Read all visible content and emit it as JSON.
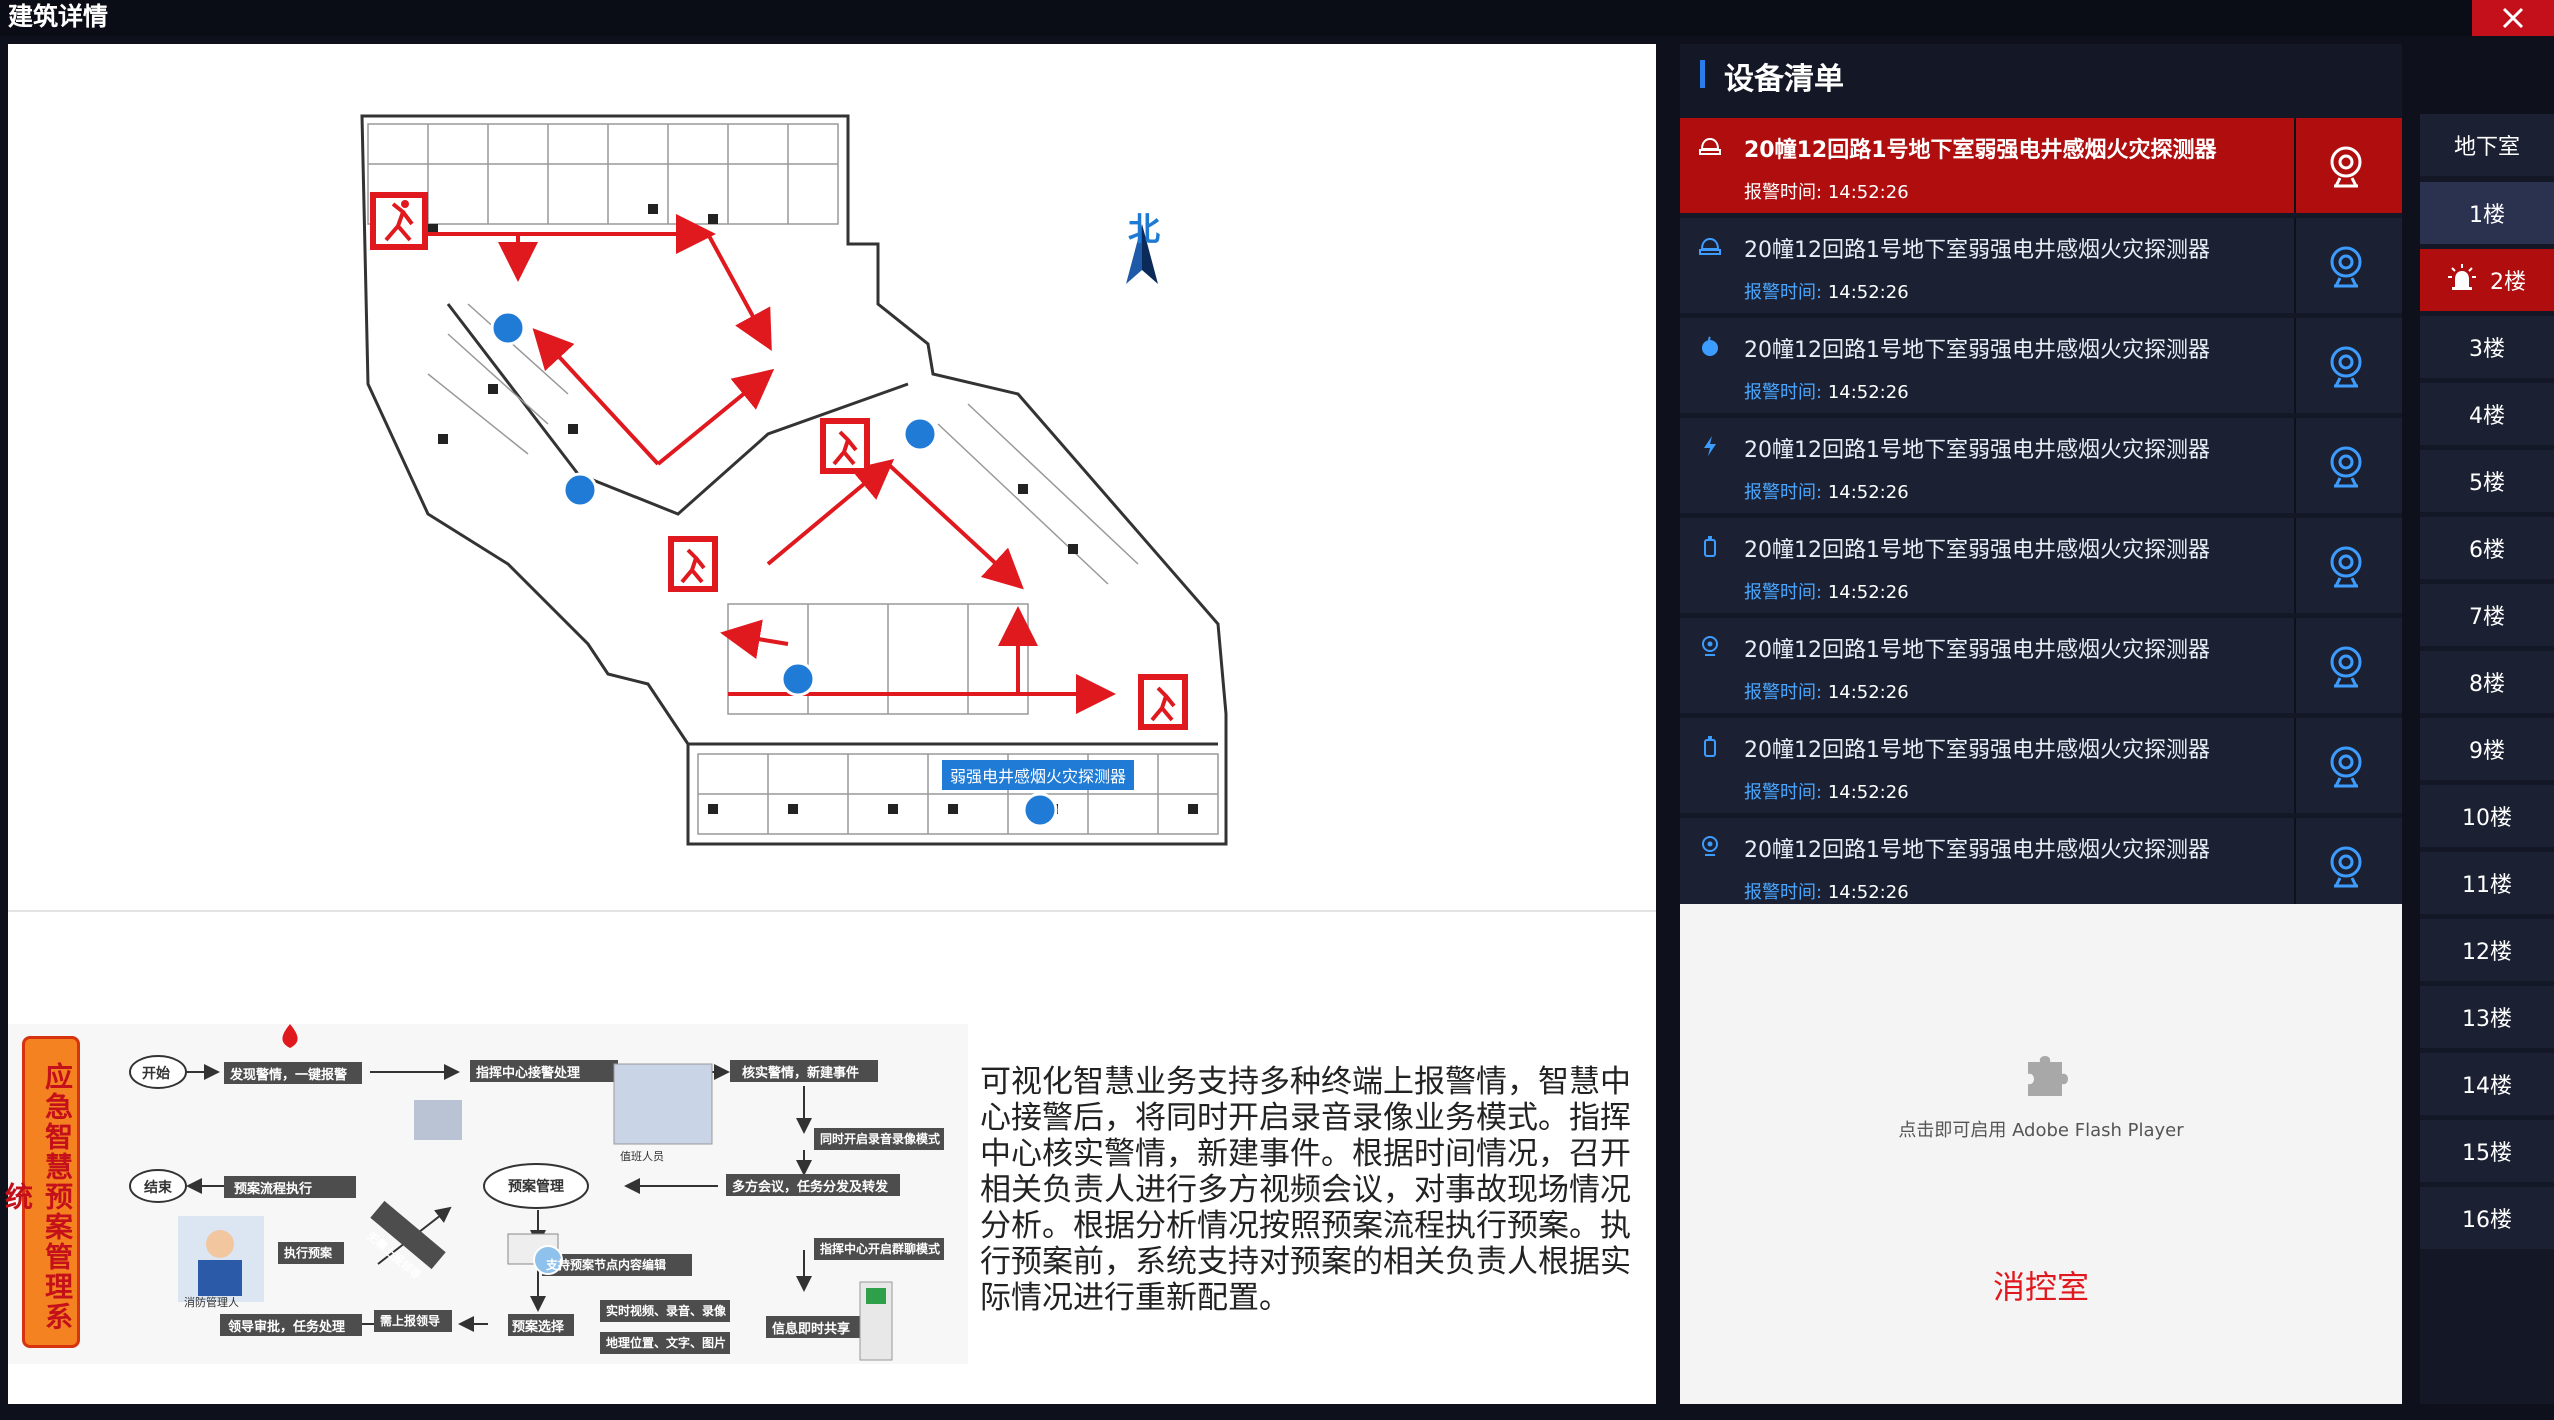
{
  "window": {
    "title": "建筑详情"
  },
  "map": {
    "north": "北",
    "device_label": "弱强电井感烟火灾探测器"
  },
  "flow": {
    "system_name": "应急智慧预案管理系统",
    "nodes": {
      "start": "开始",
      "discover": "发现警情，一键报警",
      "center_receive": "指挥中心接警处理",
      "verify": "核实警情，新建事件",
      "record": "同时开启录音录像模式",
      "meeting": "多方会议，任务分发及转发",
      "end": "结束",
      "execute": "预案流程执行",
      "plan_manage": "预案管理",
      "person": "值班人员",
      "node_edit": "支持预案节点内容编辑",
      "exec_plan": "执行预案",
      "no_report": "无需上报领导",
      "officer": "消防管理人",
      "leader_approve": "领导审批，任务处理",
      "need_report": "需上报领导",
      "select_plan": "预案选择",
      "realtime": "实时视频、录音、录像",
      "geo": "地理位置、文字、图片",
      "group_msg": "指挥中心开启群聊模式",
      "share": "信息即时共享"
    },
    "description": "可视化智慧业务支持多种终端上报警情，智慧中心接警后，将同时开启录音录像业务模式。指挥中心核实警情，新建事件。根据时间情况，召开相关负责人进行多方视频会议，对事故现场情况分析。根据分析情况按照预案流程执行预案。执行预案前，系统支持对预案的相关负责人根据实际情况进行重新配置。"
  },
  "device_panel": {
    "title": "设备清单",
    "time_label": "报警时间:",
    "items": [
      {
        "name": "20幢12回路1号地下室弱强电井感烟火灾探测器",
        "time": "14:52:26",
        "icon": "alarm-bell-icon",
        "active": true
      },
      {
        "name": "20幢12回路1号地下室弱强电井感烟火灾探测器",
        "time": "14:52:26",
        "icon": "alarm-bell-icon",
        "active": false
      },
      {
        "name": "20幢12回路1号地下室弱强电井感烟火灾探测器",
        "time": "14:52:26",
        "icon": "smoke-detector-icon",
        "active": false
      },
      {
        "name": "20幢12回路1号地下室弱强电井感烟火灾探测器",
        "time": "14:52:26",
        "icon": "lightning-icon",
        "active": false
      },
      {
        "name": "20幢12回路1号地下室弱强电井感烟火灾探测器",
        "time": "14:52:26",
        "icon": "extinguisher-icon",
        "active": false
      },
      {
        "name": "20幢12回路1号地下室弱强电井感烟火灾探测器",
        "time": "14:52:26",
        "icon": "location-icon",
        "active": false
      },
      {
        "name": "20幢12回路1号地下室弱强电井感烟火灾探测器",
        "time": "14:52:26",
        "icon": "extinguisher-icon",
        "active": false
      },
      {
        "name": "20幢12回路1号地下室弱强电井感烟火灾探测器",
        "time": "14:52:26",
        "icon": "location-icon",
        "active": false
      }
    ]
  },
  "video": {
    "flash_prompt": "点击即可启用 Adobe Flash Player",
    "room": "消控室"
  },
  "floors": {
    "items": [
      "地下室",
      "1楼",
      "2楼",
      "3楼",
      "4楼",
      "5楼",
      "6楼",
      "7楼",
      "8楼",
      "9楼",
      "10楼",
      "11楼",
      "12楼",
      "13楼",
      "14楼",
      "15楼",
      "16楼"
    ],
    "selected": "1楼",
    "alarm": "2楼"
  },
  "colors": {
    "background": "#0e111c",
    "panel": "#1b2132",
    "active_alarm": "#b00e0e",
    "accent_blue": "#2a7ce8",
    "exit_red": "#e0191f"
  }
}
